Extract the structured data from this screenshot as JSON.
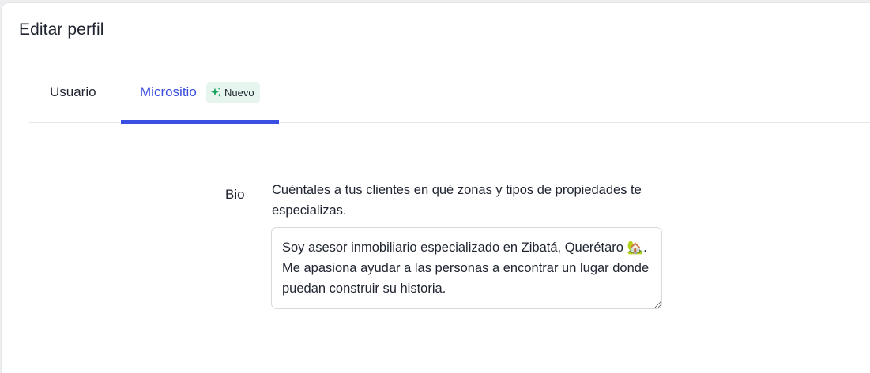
{
  "header": {
    "title": "Editar perfil"
  },
  "tabs": [
    {
      "label": "Usuario",
      "active": false
    },
    {
      "label": "Micrositio",
      "active": true,
      "badge": {
        "label": "Nuevo",
        "icon": "sparkle-icon"
      }
    }
  ],
  "bio": {
    "label": "Bio",
    "help": "Cuéntales a tus clientes en qué zonas y tipos de propiedades te especializas.",
    "value": "Soy asesor inmobiliario especializado en Zibatá, Querétaro 🏡. Me apasiona ayudar a las personas a encontrar un lugar donde puedan construir su historia."
  },
  "colors": {
    "accent": "#3b4fe0",
    "badge_bg": "#e6f6ee",
    "badge_icon": "#19a463"
  }
}
